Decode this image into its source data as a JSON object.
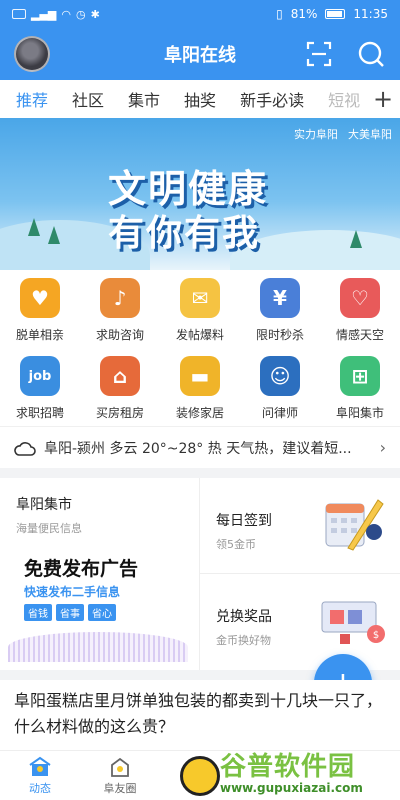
{
  "status_bar": {
    "left_icons": [
      "hd-icon",
      "signal-icon",
      "wifi-icon",
      "alarm-icon",
      "bluetooth-icon"
    ],
    "battery": "81%",
    "time": "11:35"
  },
  "header": {
    "title": "阜阳在线"
  },
  "tabs": [
    {
      "label": "推荐",
      "active": true
    },
    {
      "label": "社区"
    },
    {
      "label": "集市"
    },
    {
      "label": "抽奖"
    },
    {
      "label": "新手必读"
    },
    {
      "label": "短视"
    }
  ],
  "banner": {
    "tags": [
      "实力阜阳",
      "大美阜阳"
    ],
    "line1": "文明健康",
    "line2": "有你有我"
  },
  "grid": [
    {
      "label": "脱单相亲",
      "icon": "tshirt-couple-icon",
      "color": "#f5a623"
    },
    {
      "label": "求助咨询",
      "icon": "bell-icon",
      "color": "#e98b3a"
    },
    {
      "label": "发帖爆料",
      "icon": "envelope-icon",
      "color": "#f5c342"
    },
    {
      "label": "限时秒杀",
      "icon": "cart-icon",
      "color": "#4a7fd8"
    },
    {
      "label": "情感天空",
      "icon": "heart-chat-icon",
      "color": "#e85a5a"
    },
    {
      "label": "求职招聘",
      "icon": "job-icon",
      "color": "#3a8ee0"
    },
    {
      "label": "买房租房",
      "icon": "house-icon",
      "color": "#e66a3a"
    },
    {
      "label": "装修家居",
      "icon": "sofa-icon",
      "color": "#f0b429"
    },
    {
      "label": "问律师",
      "icon": "lawyer-icon",
      "color": "#2c6fbf"
    },
    {
      "label": "阜阳集市",
      "icon": "market-icon",
      "color": "#3fbf7a"
    }
  ],
  "weather": {
    "text": "阜阳-颍州 多云 20°~28° 热 天气热，建议着短..."
  },
  "market_card": {
    "title": "阜阳集市",
    "subtitle": "海量便民信息",
    "ad_title": "免费发布广告",
    "ad_sub": "快速发布二手信息",
    "chips": [
      "省钱",
      "省事",
      "省心"
    ]
  },
  "checkin_card": {
    "title": "每日签到",
    "subtitle": "领5金币"
  },
  "prize_card": {
    "title": "兑换奖品",
    "subtitle": "金币换好物"
  },
  "fab": {
    "label": "+"
  },
  "article": {
    "title": "阜阳蛋糕店里月饼单独包装的都卖到十几块一只了，什么材料做的这么贵？"
  },
  "bottom_nav": [
    {
      "label": "动态",
      "active": true,
      "icon": "community-icon"
    },
    {
      "label": "阜友圈",
      "icon": "friends-icon"
    }
  ],
  "watermark": {
    "brand": "谷普软件园",
    "url": "www.gupuxiazai.com"
  },
  "colors": {
    "primary": "#3a93f0"
  }
}
